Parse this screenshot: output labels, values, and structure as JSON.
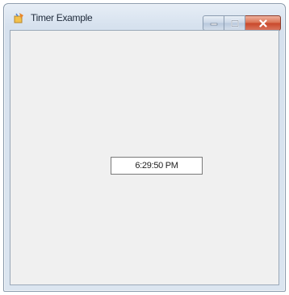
{
  "window": {
    "title": "Timer Example",
    "icon": "app-icon",
    "caption_buttons": [
      "minimize-icon",
      "maximize-icon",
      "close-icon"
    ]
  },
  "client": {
    "time_label": "6:29:50 PM"
  },
  "colors": {
    "frame": "#d6e1ee",
    "client_background": "#f0f0f0",
    "close_button": "#c9472a",
    "label_border": "#7a7a7a"
  }
}
